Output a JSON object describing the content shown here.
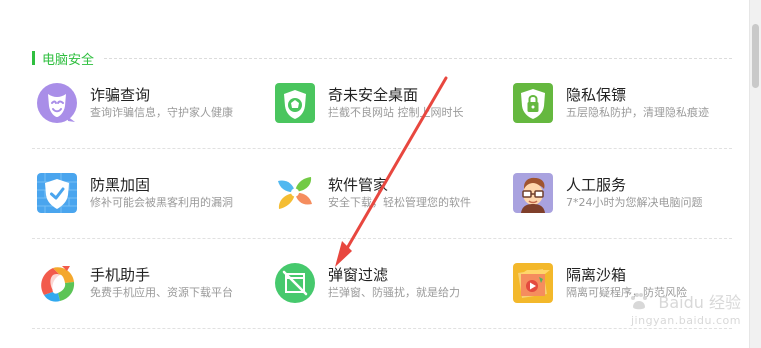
{
  "section": {
    "title": "电脑安全"
  },
  "items": [
    {
      "title": "诈骗查询",
      "desc": "查询诈骗信息，守护家人健康",
      "icon": "mask-icon",
      "color": "#a98ee8"
    },
    {
      "title": "奇未安全桌面",
      "desc": "拦截不良网站 控制上网时长",
      "icon": "shield-football-icon",
      "color": "#4ac55e"
    },
    {
      "title": "隐私保镖",
      "desc": "五层隐私防护，清理隐私痕迹",
      "icon": "lock-shield-icon",
      "color": "#65b83f"
    },
    {
      "title": "防黑加固",
      "desc": "修补可能会被黑客利用的漏洞",
      "icon": "shield-brick-icon",
      "color": "#4aa5ee"
    },
    {
      "title": "软件管家",
      "desc": "安全下载，轻松管理您的软件",
      "icon": "flower-icon",
      "color": "#4fb8f0"
    },
    {
      "title": "人工服务",
      "desc": "7*24小时为您解决电脑问题",
      "icon": "service-person-icon",
      "color": "#a9a2df"
    },
    {
      "title": "手机助手",
      "desc": "免费手机应用、资源下载平台",
      "icon": "rainbow-ball-icon",
      "color": "#f09a2c"
    },
    {
      "title": "弹窗过滤",
      "desc": "拦弹窗、防骚扰，就是给力",
      "icon": "popup-filter-icon",
      "color": "#46c96d"
    },
    {
      "title": "隔离沙箱",
      "desc": "隔离可疑程序，防范风险",
      "icon": "sandbox-icon",
      "color": "#f3b82b"
    }
  ],
  "watermark": {
    "text": "Baidu 经验",
    "url": "jingyan.baidu.com"
  },
  "colors": {
    "accent": "#2fbf3f",
    "arrow": "#e8473f",
    "divider": "#e1e1e1",
    "title": "#222222",
    "description": "#9a9a9a"
  }
}
